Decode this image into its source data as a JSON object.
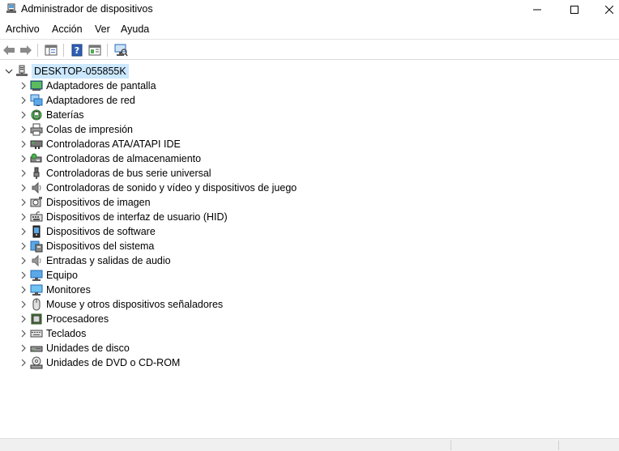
{
  "window": {
    "title": "Administrador de dispositivos"
  },
  "menu": [
    "Archivo",
    "Acción",
    "Ver",
    "Ayuda"
  ],
  "tree": {
    "root": "DESKTOP-055855K",
    "items": [
      {
        "label": "Adaptadores de pantalla",
        "icon": "display-adapter-icon"
      },
      {
        "label": "Adaptadores de red",
        "icon": "network-adapter-icon"
      },
      {
        "label": "Baterías",
        "icon": "battery-icon"
      },
      {
        "label": "Colas de impresión",
        "icon": "printer-icon"
      },
      {
        "label": "Controladoras ATA/ATAPI IDE",
        "icon": "ide-controller-icon"
      },
      {
        "label": "Controladoras de almacenamiento",
        "icon": "storage-controller-icon"
      },
      {
        "label": "Controladoras de bus serie universal",
        "icon": "usb-icon"
      },
      {
        "label": "Controladoras de sonido y vídeo y dispositivos de juego",
        "icon": "speaker-icon"
      },
      {
        "label": "Dispositivos de imagen",
        "icon": "camera-icon"
      },
      {
        "label": "Dispositivos de interfaz de usuario (HID)",
        "icon": "hid-icon"
      },
      {
        "label": "Dispositivos de software",
        "icon": "software-device-icon"
      },
      {
        "label": "Dispositivos del sistema",
        "icon": "system-device-icon"
      },
      {
        "label": "Entradas y salidas de audio",
        "icon": "audio-io-icon"
      },
      {
        "label": "Equipo",
        "icon": "computer-icon"
      },
      {
        "label": "Monitores",
        "icon": "monitor-icon"
      },
      {
        "label": "Mouse y otros dispositivos señaladores",
        "icon": "mouse-icon"
      },
      {
        "label": "Procesadores",
        "icon": "processor-icon"
      },
      {
        "label": "Teclados",
        "icon": "keyboard-icon"
      },
      {
        "label": "Unidades de disco",
        "icon": "disk-drive-icon"
      },
      {
        "label": "Unidades de DVD o CD-ROM",
        "icon": "dvd-drive-icon"
      }
    ]
  }
}
